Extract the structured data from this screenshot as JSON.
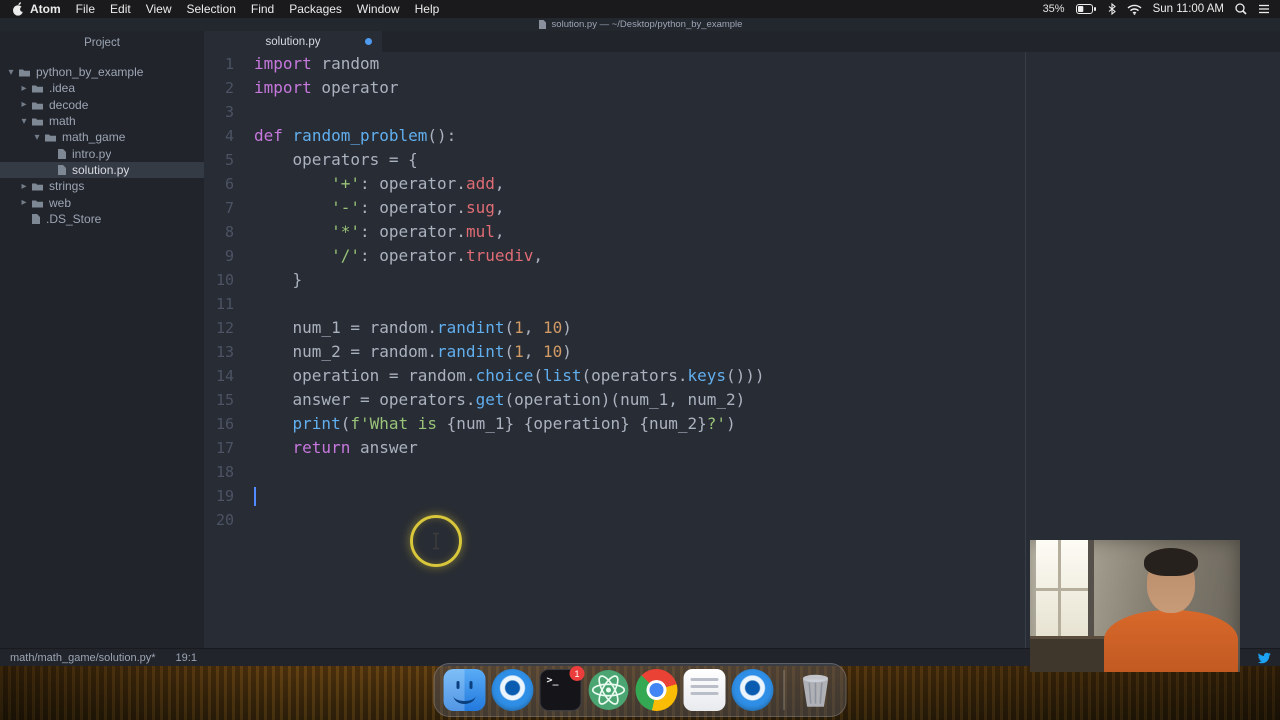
{
  "menu_bar": {
    "items": [
      "Atom",
      "File",
      "Edit",
      "View",
      "Selection",
      "Find",
      "Packages",
      "Window",
      "Help"
    ],
    "status": {
      "battery": "35%",
      "clock": "Sun 11:00 AM"
    }
  },
  "window": {
    "title": "solution.py — ~/Desktop/python_by_example"
  },
  "sidebar": {
    "header": "Project",
    "tree": [
      {
        "label": "python_by_example",
        "type": "folder",
        "expanded": true,
        "depth": 0
      },
      {
        "label": ".idea",
        "type": "folder",
        "expanded": false,
        "depth": 1
      },
      {
        "label": "decode",
        "type": "folder",
        "expanded": false,
        "depth": 1
      },
      {
        "label": "math",
        "type": "folder",
        "expanded": true,
        "depth": 1
      },
      {
        "label": "math_game",
        "type": "folder",
        "expanded": true,
        "depth": 2
      },
      {
        "label": "intro.py",
        "type": "file",
        "depth": 3
      },
      {
        "label": "solution.py",
        "type": "file",
        "depth": 3,
        "selected": true
      },
      {
        "label": "strings",
        "type": "folder",
        "expanded": false,
        "depth": 1
      },
      {
        "label": "web",
        "type": "folder",
        "expanded": false,
        "depth": 1
      },
      {
        "label": ".DS_Store",
        "type": "file",
        "depth": 1
      }
    ]
  },
  "tabbar": {
    "tabs": [
      {
        "label": "solution.py",
        "modified": true,
        "active": true
      }
    ]
  },
  "editor": {
    "cursor_line": 19,
    "lines": [
      {
        "n": 1,
        "segs": [
          [
            "kw",
            "import"
          ],
          [
            "pl",
            " random"
          ]
        ]
      },
      {
        "n": 2,
        "segs": [
          [
            "kw",
            "import"
          ],
          [
            "pl",
            " operator"
          ]
        ]
      },
      {
        "n": 3,
        "segs": []
      },
      {
        "n": 4,
        "segs": [
          [
            "kw",
            "def"
          ],
          [
            "pl",
            " "
          ],
          [
            "fn",
            "random_problem"
          ],
          [
            "pl",
            "():"
          ]
        ]
      },
      {
        "n": 5,
        "segs": [
          [
            "pl",
            "    operators = {"
          ]
        ]
      },
      {
        "n": 6,
        "segs": [
          [
            "pl",
            "        "
          ],
          [
            "str",
            "'+'"
          ],
          [
            "pl",
            ": operator."
          ],
          [
            "prop",
            "add"
          ],
          [
            "pl",
            ","
          ]
        ]
      },
      {
        "n": 7,
        "segs": [
          [
            "pl",
            "        "
          ],
          [
            "str",
            "'-'"
          ],
          [
            "pl",
            ": operator."
          ],
          [
            "prop",
            "sug"
          ],
          [
            "pl",
            ","
          ]
        ]
      },
      {
        "n": 8,
        "segs": [
          [
            "pl",
            "        "
          ],
          [
            "str",
            "'*'"
          ],
          [
            "pl",
            ": operator."
          ],
          [
            "prop",
            "mul"
          ],
          [
            "pl",
            ","
          ]
        ]
      },
      {
        "n": 9,
        "segs": [
          [
            "pl",
            "        "
          ],
          [
            "str",
            "'/'"
          ],
          [
            "pl",
            ": operator."
          ],
          [
            "prop",
            "truediv"
          ],
          [
            "pl",
            ","
          ]
        ]
      },
      {
        "n": 10,
        "segs": [
          [
            "pl",
            "    }"
          ]
        ]
      },
      {
        "n": 11,
        "segs": []
      },
      {
        "n": 12,
        "segs": [
          [
            "pl",
            "    num_1 = random."
          ],
          [
            "fn",
            "randint"
          ],
          [
            "pl",
            "("
          ],
          [
            "num",
            "1"
          ],
          [
            "pl",
            ", "
          ],
          [
            "num",
            "10"
          ],
          [
            "pl",
            ")"
          ]
        ]
      },
      {
        "n": 13,
        "segs": [
          [
            "pl",
            "    num_2 = random."
          ],
          [
            "fn",
            "randint"
          ],
          [
            "pl",
            "("
          ],
          [
            "num",
            "1"
          ],
          [
            "pl",
            ", "
          ],
          [
            "num",
            "10"
          ],
          [
            "pl",
            ")"
          ]
        ]
      },
      {
        "n": 14,
        "segs": [
          [
            "pl",
            "    operation = random."
          ],
          [
            "fn",
            "choice"
          ],
          [
            "pl",
            "("
          ],
          [
            "fn",
            "list"
          ],
          [
            "pl",
            "(operators."
          ],
          [
            "fn",
            "keys"
          ],
          [
            "pl",
            "()))"
          ]
        ]
      },
      {
        "n": 15,
        "segs": [
          [
            "pl",
            "    answer = operators."
          ],
          [
            "fn",
            "get"
          ],
          [
            "pl",
            "(operation)(num_1, num_2)"
          ]
        ]
      },
      {
        "n": 16,
        "segs": [
          [
            "pl",
            "    "
          ],
          [
            "fn",
            "print"
          ],
          [
            "pl",
            "("
          ],
          [
            "str",
            "f'What is "
          ],
          [
            "pl",
            "{num_1}"
          ],
          [
            "str",
            " "
          ],
          [
            "pl",
            "{operation}"
          ],
          [
            "str",
            " "
          ],
          [
            "pl",
            "{num_2}"
          ],
          [
            "str",
            "?'"
          ],
          [
            "pl",
            ")"
          ]
        ]
      },
      {
        "n": 17,
        "segs": [
          [
            "pl",
            "    "
          ],
          [
            "kw",
            "return"
          ],
          [
            "pl",
            " answer"
          ]
        ]
      },
      {
        "n": 18,
        "segs": []
      },
      {
        "n": 19,
        "segs": []
      },
      {
        "n": 20,
        "segs": []
      }
    ]
  },
  "status_bar": {
    "path": "math/math_game/solution.py*",
    "position": "19:1"
  },
  "dock": {
    "icons": [
      {
        "name": "finder"
      },
      {
        "name": "circle-app"
      },
      {
        "name": "terminal",
        "badge": "1"
      },
      {
        "name": "atom"
      },
      {
        "name": "chrome"
      },
      {
        "name": "document-app"
      },
      {
        "name": "circle-app"
      },
      {
        "name": "trash",
        "divider_before": true
      }
    ]
  },
  "theme": {
    "editor_bg": "#282c34",
    "panel_bg": "#21252b",
    "keyword_purple": "#c678dd",
    "function_blue": "#61afef",
    "property_red": "#e06c75",
    "string_green": "#98c379",
    "number_orange": "#d19a66",
    "text_gray": "#abb2bf",
    "highlight_yellow": "#ebd73c",
    "twitter_blue": "#1da1f2"
  }
}
